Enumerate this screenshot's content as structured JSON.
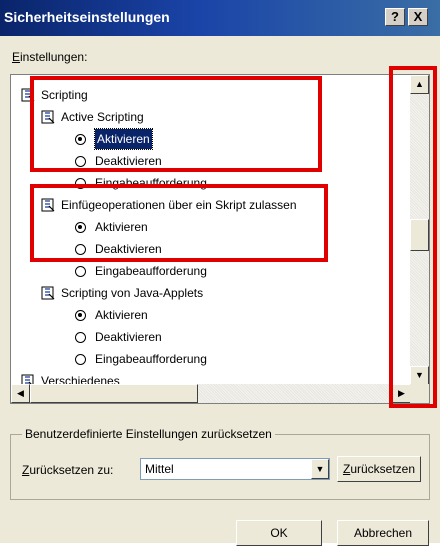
{
  "window": {
    "title": "Sicherheitseinstellungen",
    "help_label": "?",
    "close_label": "X"
  },
  "settings_label": {
    "mnemonic": "E",
    "rest": "instellungen:"
  },
  "tree": [
    {
      "label": "Scripting",
      "icon": "script-settings-icon",
      "kind": "category"
    },
    {
      "label": "Active Scripting",
      "icon": "script-settings-icon",
      "kind": "setting"
    },
    {
      "label": "Aktivieren",
      "kind": "option",
      "selected": true,
      "focused": true
    },
    {
      "label": "Deaktivieren",
      "kind": "option",
      "selected": false
    },
    {
      "label": "Eingabeaufforderung",
      "kind": "option",
      "selected": false
    },
    {
      "label": "Einfügeoperationen über ein Skript zulassen",
      "icon": "script-settings-icon",
      "kind": "setting"
    },
    {
      "label": "Aktivieren",
      "kind": "option",
      "selected": true
    },
    {
      "label": "Deaktivieren",
      "kind": "option",
      "selected": false
    },
    {
      "label": "Eingabeaufforderung",
      "kind": "option",
      "selected": false
    },
    {
      "label": "Scripting von Java-Applets",
      "icon": "script-settings-icon",
      "kind": "setting"
    },
    {
      "label": "Aktivieren",
      "kind": "option",
      "selected": true
    },
    {
      "label": "Deaktivieren",
      "kind": "option",
      "selected": false
    },
    {
      "label": "Eingabeaufforderung",
      "kind": "option",
      "selected": false
    },
    {
      "label": "Verschiedenes",
      "icon": "folder-settings-icon",
      "kind": "category"
    }
  ],
  "reset_group": {
    "legend": "Benutzerdefinierte Einstellungen zurücksetzen",
    "reset_to": {
      "mnemonic": "Z",
      "rest": "urücksetzen zu:"
    },
    "level_value": "Mittel",
    "reset_button": {
      "mnemonic": "Z",
      "rest": "urücksetzen"
    }
  },
  "buttons": {
    "ok": "OK",
    "cancel": "Abbrechen"
  },
  "colors": {
    "highlight": "#e00000",
    "titlebar": "#0a246a",
    "selection": "#0a246a"
  }
}
